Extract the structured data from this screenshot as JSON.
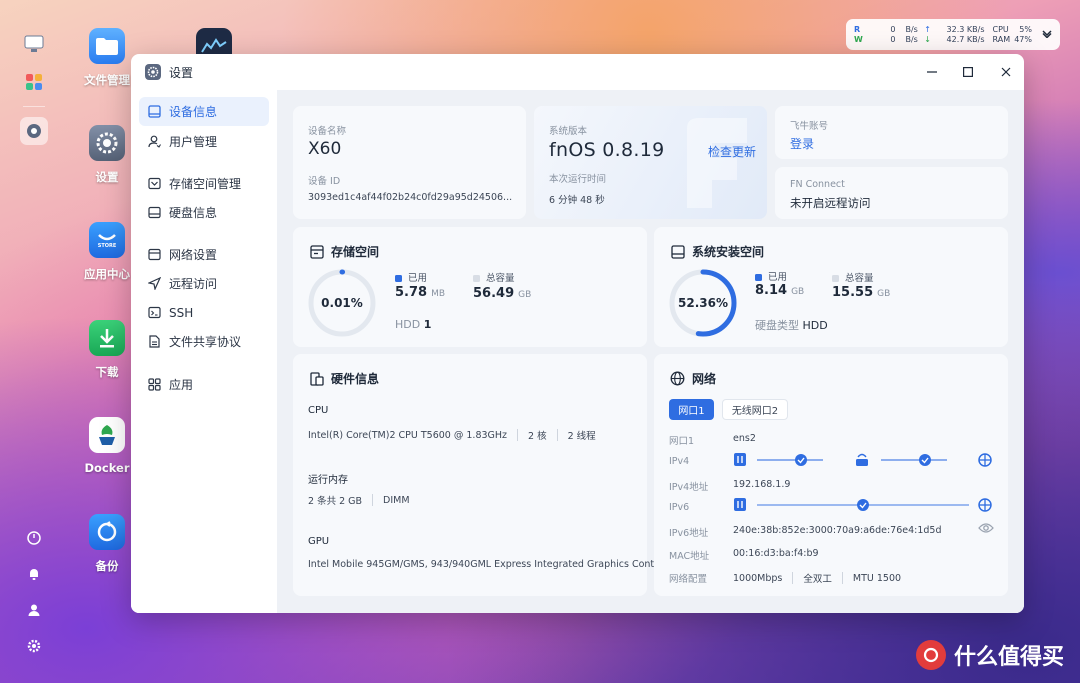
{
  "desktop": {
    "icons": [
      {
        "label": "文件管理"
      },
      {
        "label": "设置"
      },
      {
        "label": "应用中心"
      },
      {
        "label": "下载"
      },
      {
        "label": "Docker"
      },
      {
        "label": "备份"
      }
    ],
    "store_badge": "STORE"
  },
  "sys_widget": {
    "r_label": "R",
    "w_label": "W",
    "r_value": "0",
    "w_value": "0",
    "r_unit": "B/s",
    "w_unit": "B/s",
    "up_value": "32.3 KB/s",
    "down_value": "42.7 KB/s",
    "cpu_label": "CPU",
    "ram_label": "RAM",
    "cpu_value": "5%",
    "ram_value": "47%"
  },
  "window": {
    "title": "设置",
    "sidebar": [
      {
        "label": "设备信息",
        "icon": "device-icon"
      },
      {
        "label": "用户管理",
        "icon": "user-icon"
      },
      {
        "label": "存储空间管理",
        "icon": "storage-icon"
      },
      {
        "label": "硬盘信息",
        "icon": "disk-icon"
      },
      {
        "label": "网络设置",
        "icon": "network-icon"
      },
      {
        "label": "远程访问",
        "icon": "remote-icon"
      },
      {
        "label": "SSH",
        "icon": "ssh-icon"
      },
      {
        "label": "文件共享协议",
        "icon": "share-icon"
      },
      {
        "label": "应用",
        "icon": "apps-icon"
      }
    ],
    "device": {
      "name_label": "设备名称",
      "name": "X60",
      "id_label": "设备 ID",
      "id": "3093ed1c4af44f02b24c0fd29a95d24506..."
    },
    "system": {
      "version_label": "系统版本",
      "version": "fnOS  0.8.19",
      "update_link": "检查更新",
      "uptime_label": "本次运行时间",
      "uptime": "6 分钟 48 秒"
    },
    "account": {
      "label": "飞牛账号",
      "login": "登录"
    },
    "fnconnect": {
      "label": "FN Connect",
      "status": "未开启远程访问"
    },
    "storage": {
      "title": "存储空间",
      "percent": "0.01%",
      "percent_value": 0.01,
      "used_label": "已用",
      "used_value": "5.78",
      "used_unit": "MB",
      "total_label": "总容量",
      "total_value": "56.49",
      "total_unit": "GB",
      "hdd_label": "HDD",
      "hdd_count": "1"
    },
    "system_storage": {
      "title": "系统安装空间",
      "percent": "52.36%",
      "percent_value": 52.36,
      "used_label": "已用",
      "used_value": "8.14",
      "used_unit": "GB",
      "total_label": "总容量",
      "total_value": "15.55",
      "total_unit": "GB",
      "disk_type_label": "硬盘类型",
      "disk_type": "HDD"
    },
    "hardware": {
      "title": "硬件信息",
      "cpu_label": "CPU",
      "cpu_model": "Intel(R) Core(TM)2 CPU T5600 @ 1.83GHz",
      "cpu_cores": "2 核",
      "cpu_threads": "2 线程",
      "ram_label": "运行内存",
      "ram_desc": "2 条共 2 GB",
      "ram_type": "DIMM",
      "gpu_label": "GPU",
      "gpu_model": "Intel Mobile 945GM/GMS, 943/940GML Express Integrated Graphics Cont..."
    },
    "network": {
      "title": "网络",
      "tabs": [
        {
          "label": "网口1"
        },
        {
          "label": "无线网口2"
        }
      ],
      "rows": [
        {
          "label": "网口1",
          "value": "ens2"
        },
        {
          "label": "IPv4"
        },
        {
          "label": "IPv4地址",
          "value": "192.168.1.9"
        },
        {
          "label": "IPv6"
        },
        {
          "label": "IPv6地址",
          "value": "240e:38b:852e:3000:70a9:a6de:76e4:1d5d"
        },
        {
          "label": "MAC地址",
          "value": "00:16:d3:ba:f4:b9"
        },
        {
          "label": "网络配置"
        }
      ],
      "config": [
        "1000Mbps",
        "全双工",
        "MTU 1500"
      ]
    }
  },
  "watermark": "什么值得买",
  "colors": {
    "accent": "#2f6de1",
    "ring_track": "#e3e8ef"
  }
}
